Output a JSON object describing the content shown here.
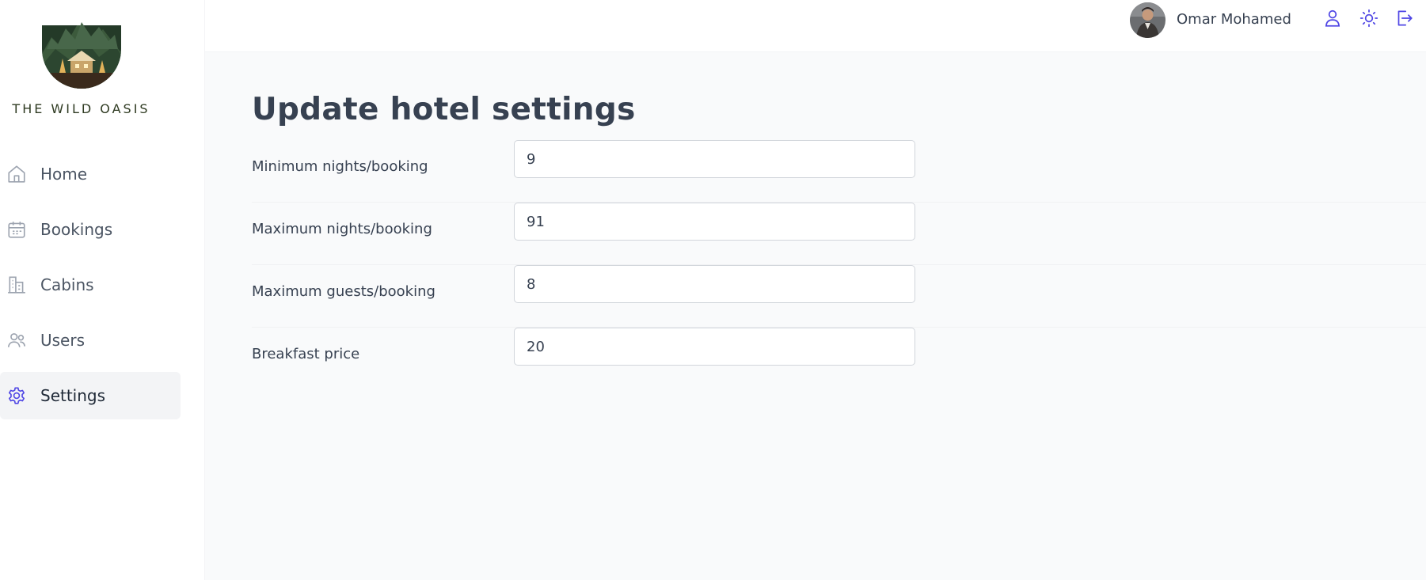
{
  "brand": {
    "name": "THE WILD OASIS"
  },
  "sidebar": {
    "items": [
      {
        "label": "Home",
        "icon": "home-icon",
        "active": false
      },
      {
        "label": "Bookings",
        "icon": "calendar-icon",
        "active": false
      },
      {
        "label": "Cabins",
        "icon": "buildings-icon",
        "active": false
      },
      {
        "label": "Users",
        "icon": "users-icon",
        "active": false
      },
      {
        "label": "Settings",
        "icon": "gear-icon",
        "active": true
      }
    ]
  },
  "header": {
    "user_name": "Omar Mohamed",
    "icons": [
      "user-icon",
      "sun-icon",
      "logout-icon"
    ],
    "accent_color": "#4f46e5"
  },
  "main": {
    "title": "Update hotel settings",
    "fields": [
      {
        "label": "Minimum nights/booking",
        "value": "9"
      },
      {
        "label": "Maximum nights/booking",
        "value": "91"
      },
      {
        "label": "Maximum guests/booking",
        "value": "8"
      },
      {
        "label": "Breakfast price",
        "value": "20"
      }
    ]
  }
}
